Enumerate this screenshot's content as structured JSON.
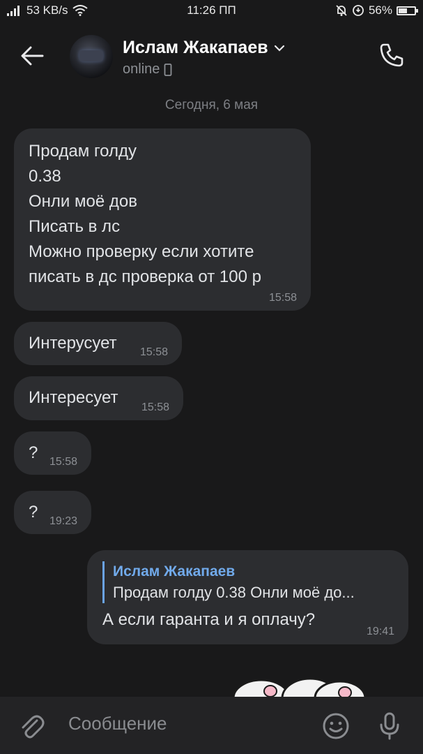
{
  "status_bar": {
    "network_speed": "53 KB/s",
    "time": "11:26 ПП",
    "battery": "56%",
    "battery_level": 0.56
  },
  "header": {
    "contact_name": "Ислам Жакапаев",
    "contact_status": "online"
  },
  "date_separator": "Сегодня, 6 мая",
  "messages": [
    {
      "text": "Продам голду\n0.38\nОнли моё дов\nПисать в лс\nМожно проверку если хотите\nписать  в дс проверка от 100 р",
      "time": "15:58"
    },
    {
      "text": "Интерусует",
      "time": "15:58"
    },
    {
      "text": "Интересует",
      "time": "15:58"
    },
    {
      "text": "?",
      "time": "15:58"
    },
    {
      "text": "?",
      "time": "19:23"
    }
  ],
  "outgoing": {
    "reply_author": "Ислам Жакапаев",
    "reply_text": "Продам голду  0.38 Онли моё до...",
    "text": "А если гаранта и я оплачу?",
    "time": "19:41"
  },
  "input": {
    "placeholder": "Сообщение"
  },
  "icons": {
    "back": "back-arrow-icon",
    "call": "phone-icon",
    "attach": "paperclip-icon",
    "emoji": "emoji-icon",
    "mic": "microphone-icon"
  }
}
